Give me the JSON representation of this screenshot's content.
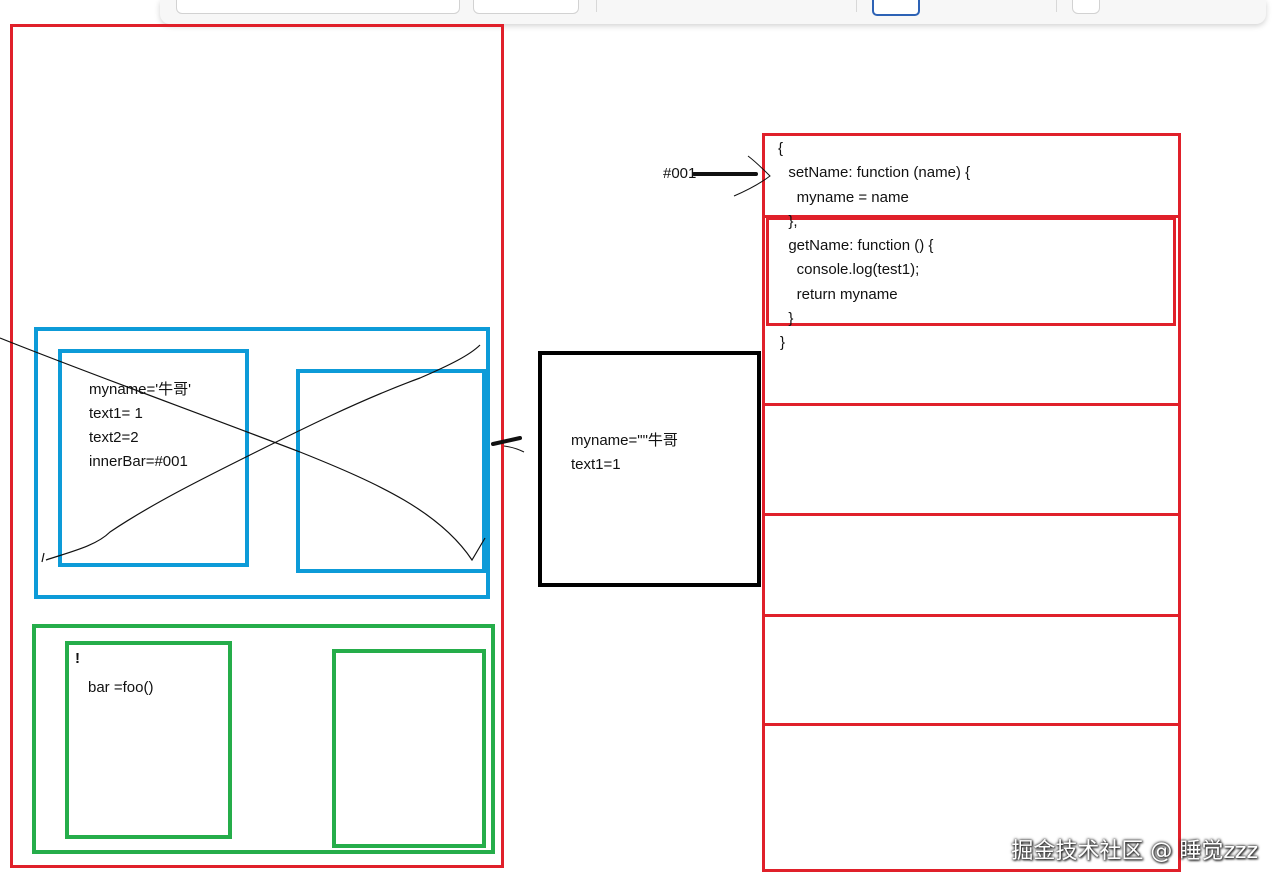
{
  "stack": {
    "outer_frame": {
      "closure_frame": {
        "left_vars": [
          "myname='牛哥'",
          "text1= 1",
          "text2=2",
          "innerBar=#001"
        ]
      },
      "global_frame": {
        "left_marker": "!",
        "left_vars": [
          "bar =foo()"
        ]
      }
    }
  },
  "closure_object": {
    "vars": [
      "myname=\"\"牛哥",
      "text1=1"
    ]
  },
  "heap": {
    "address_label": "#001",
    "code_lines": [
      "{",
      "  setName: function (name) {",
      "    myname = name",
      "  },",
      "  getName: function () {",
      "    console.log(test1);",
      "    return myname",
      "  }",
      "}"
    ]
  },
  "watermark": "掘金技术社区 @ 睡觉zzz",
  "colors": {
    "red": "#e0202a",
    "blue": "#0d9bd8",
    "green": "#25ad4a",
    "black": "#000000"
  }
}
